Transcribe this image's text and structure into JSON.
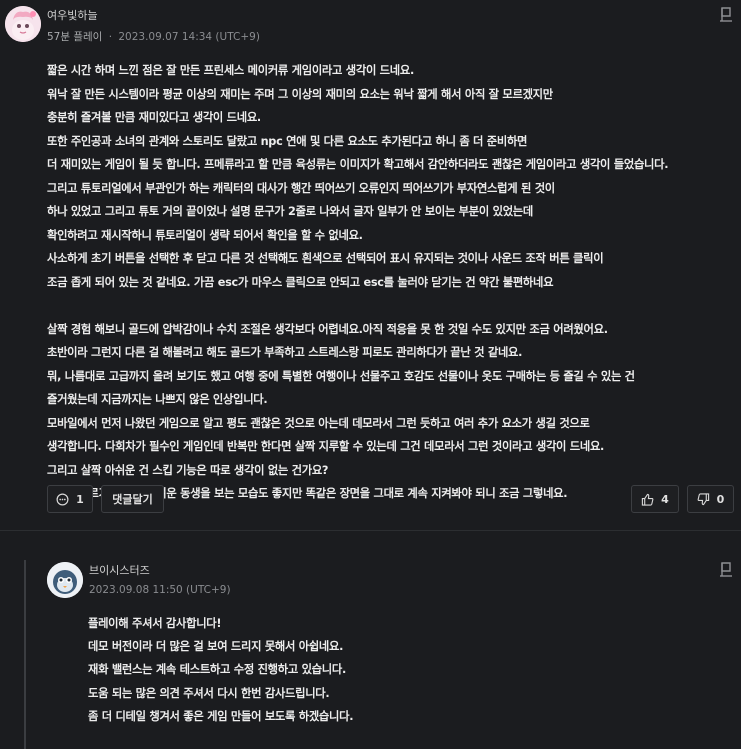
{
  "review": {
    "username": "여우빛하늘",
    "playtime": "57분 플레이",
    "separator": "·",
    "timestamp": "2023.09.07 14:34 (UTC+9)",
    "lines": [
      "짧은 시간 하며 느낀 점은 잘 만든 프린세스 메이커류 게임이라고 생각이 드네요.",
      "워낙 잘 만든 시스템이라 평균 이상의 재미는 주며 그 이상의 재미의 요소는 워낙 짧게 해서 아직 잘 모르겠지만",
      "충분히 즐겨볼 만큼 재미있다고 생각이 드네요.",
      "또한 주인공과 소녀의 관계와 스토리도 달랐고 npc 연애 및 다른 요소도 추가된다고 하니 좀 더 준비하면",
      "더 재미있는 게임이 될 듯 합니다. 프메류라고 할 만큼 육성류는 이미지가 확고해서 감안하더라도 괜찮은 게임이라고 생각이 들었습니다.",
      "그리고 튜토리얼에서 부관인가 하는 캐릭터의 대사가 행간 띄어쓰기 오류인지 띄어쓰기가 부자연스럽게 된 것이",
      "하나 있었고 그리고 튜토 거의 끝이었나 설명 문구가 2줄로 나와서 글자 일부가 안 보이는 부분이 있었는데",
      "확인하려고 재시작하니 튜토리얼이 생략 되어서 확인을 할 수 없네요.",
      "사소하게 초기 버튼을 선택한 후 닫고 다른 것 선택해도 흰색으로 선택되어 표시 유지되는 것이나 사운드 조작 버튼 클릭이",
      "조금 좁게 되어 있는 것 같네요. 가끔 esc가 마우스  클릭으로 안되고 esc를  눌러야 닫기는 건 약간 불편하네요",
      "",
      "살짝 경험 해보니 골드에 압박감이나 수치 조절은 생각보다 어렵네요.아직 적응을 못 한 것일 수도 있지만 조금 어려웠어요.",
      "초반이라 그런지 다른 걸 해볼려고 해도 골드가 부족하고 스트레스랑 피로도 관리하다가 끝난 것 같네요.",
      "뭐, 나름대로 고급까지 올려 보기도 했고 여행 중에 특별한 여행이나 선물주고 호감도 선물이나 옷도 구매하는 등 즐길 수 있는 건",
      "즐거웠는데 지금까지는 나쁘지 않은 인상입니다.",
      "모바일에서 먼저 나왔던 게임으로 알고 평도 괜찮은 것으로 아는데 데모라서 그런 듯하고  여러 추가 요소가 생길 것으로",
      "생각합니다. 다회차가 필수인 게임인데 반복만 한다면 살짝 지루할 수 있는데 그건 데모라서 그런 것이라고 생각이 드네요.",
      "그리고 살짝 아쉬운 건 스킵 기능은 따로 생각이 없는 건가요?",
      "3배도 빠르기는 하고 귀여운 동생을 보는 모습도 좋지만 똑같은 장면을  그대로 계속 지켜봐야 되니 조금 그렇네요."
    ],
    "comment_count": "1",
    "reply_label": "댓글달기",
    "like_count": "4",
    "dislike_count": "0"
  },
  "reply": {
    "username": "브이시스터즈",
    "timestamp": "2023.09.08 11:50 (UTC+9)",
    "lines": [
      "플레이해 주셔서 감사합니다!",
      "데모 버전이라 더 많은 걸 보여 드리지 못해서 아쉽네요.",
      "재화 밸런스는 계속 테스트하고 수정 진행하고 있습니다.",
      "도움 되는 많은 의견 주셔서 다시 한번 감사드립니다.",
      "좀 더 디테일 챙겨서 좋은 게임 만들어 보도록 하겠습니다."
    ]
  },
  "icons": {
    "flag": "flag-icon",
    "comment": "comment-icon",
    "thumbs_up": "thumbs-up-icon",
    "thumbs_down": "thumbs-down-icon"
  },
  "colors": {
    "background": "#1b1c1f",
    "text": "#ededed",
    "meta": "#8a8c90",
    "border": "#3c3e42"
  }
}
